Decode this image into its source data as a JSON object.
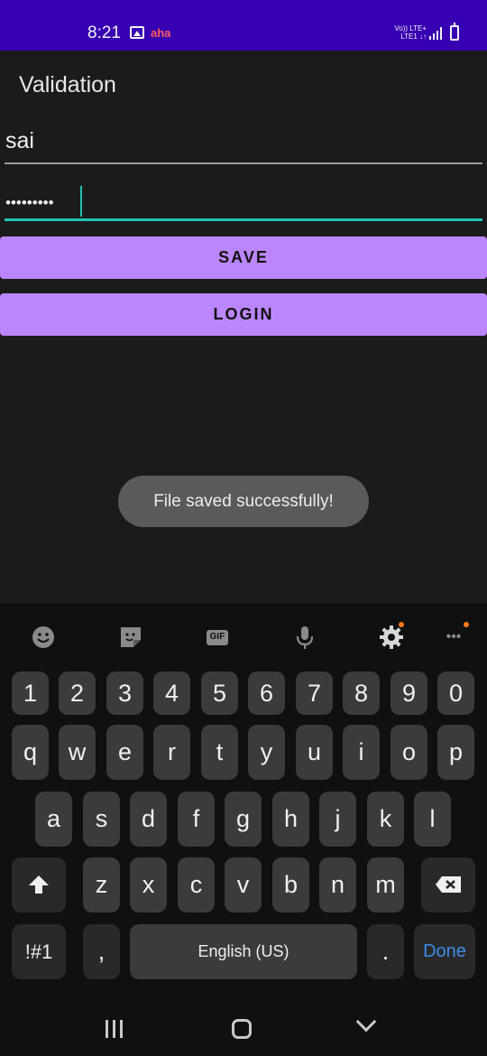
{
  "status_bar": {
    "time": "8:21",
    "carrier_badge": "aha",
    "network_line1": "Vo)) LTE+",
    "network_line2": "LTE1 ↓↑",
    "background": "#3700b3"
  },
  "app": {
    "title": "Validation",
    "username_value": "sai",
    "password_dots": "•••••••••",
    "save_label": "SAVE",
    "login_label": "LOGIN",
    "accent": "#bb86fc",
    "field_accent": "#1ec4b5"
  },
  "toast": {
    "message": "File saved successfully!"
  },
  "keyboard": {
    "toolbar": {
      "emoji_icon": "emoji-icon",
      "sticker_icon": "sticker-icon",
      "gif_label": "GIF",
      "mic_icon": "microphone-icon",
      "settings_icon": "gear-icon",
      "more_label": "•••"
    },
    "number_row": [
      "1",
      "2",
      "3",
      "4",
      "5",
      "6",
      "7",
      "8",
      "9",
      "0"
    ],
    "row1": [
      "q",
      "w",
      "e",
      "r",
      "t",
      "y",
      "u",
      "i",
      "o",
      "p"
    ],
    "row2": [
      "a",
      "s",
      "d",
      "f",
      "g",
      "h",
      "j",
      "k",
      "l"
    ],
    "row3": [
      "z",
      "x",
      "c",
      "v",
      "b",
      "n",
      "m"
    ],
    "symbols_label": "!#1",
    "comma_label": ",",
    "space_label": "English (US)",
    "period_label": ".",
    "done_label": "Done"
  }
}
